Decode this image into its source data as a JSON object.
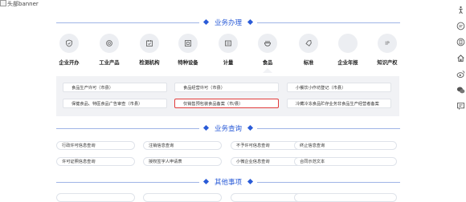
{
  "banner": {
    "alt_text": "头部banner"
  },
  "sections": {
    "business": {
      "title": "业务办理"
    },
    "query": {
      "title": "业务查询"
    },
    "other": {
      "title": "其他事项"
    }
  },
  "categories": [
    {
      "label": "企业开办",
      "icon": "shield-icon"
    },
    {
      "label": "工业产品",
      "icon": "gear-icon"
    },
    {
      "label": "检测机构",
      "icon": "calendar-check-icon"
    },
    {
      "label": "特种设备",
      "icon": "equipment-icon"
    },
    {
      "label": "计量",
      "icon": "scale-icon"
    },
    {
      "label": "食品",
      "icon": "food-bowl-icon",
      "active": true
    },
    {
      "label": "标准",
      "icon": "tag-icon"
    },
    {
      "label": "企业年报",
      "icon": "blank-icon"
    },
    {
      "label": "知识产权",
      "icon": "ip-icon",
      "icon_text": "IP"
    }
  ],
  "food_services": [
    {
      "label": "食品生产许可（市县）"
    },
    {
      "label": "食品经营许可（市县）"
    },
    {
      "label": "小餐饮小作坊登记（市县）"
    },
    {
      "label": "保健食品、特医食品广告审查（市县）"
    },
    {
      "label": "仅销售预包装食品备案（市/县）",
      "selected": true
    },
    {
      "label": "冷藏冷冻食品贮存业务非食品生产经营者备案"
    }
  ],
  "query_items": [
    {
      "label": "行政许可信息查询"
    },
    {
      "label": "注销信息查询"
    },
    {
      "label": "不予许可信息查询"
    },
    {
      "label": "终止信息查询"
    },
    {
      "label": "许可证照信息查询"
    },
    {
      "label": "授权签字人申请表"
    },
    {
      "label": "小微企业信息查询"
    },
    {
      "label": "合同示范文本"
    }
  ],
  "sidebar_icons": [
    "accessibility-icon",
    "chat-icon",
    "phone-icon",
    "home-icon",
    "weibo-icon",
    "wechat-icon",
    "message-icon"
  ]
}
